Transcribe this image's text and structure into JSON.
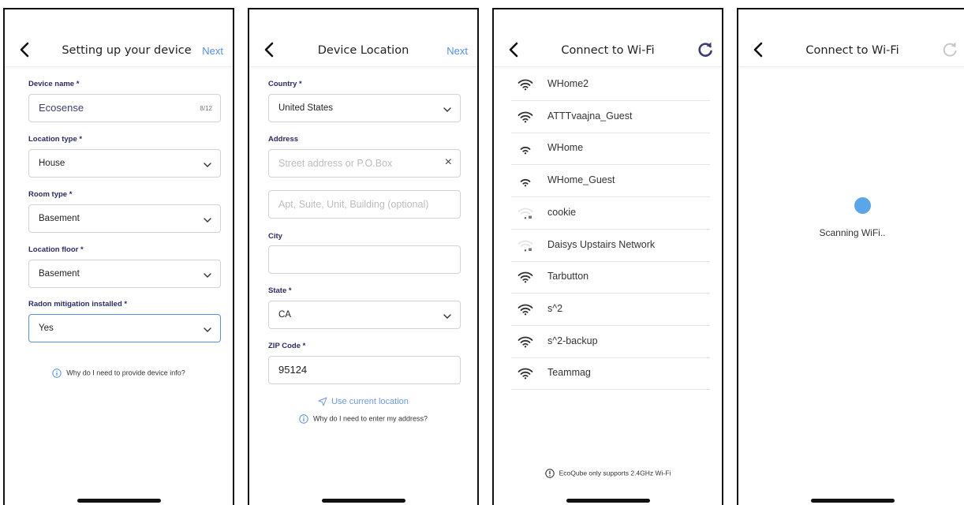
{
  "screen1": {
    "title": "Setting up your device",
    "next_label": "Next",
    "fields": [
      {
        "label": "Device name *",
        "value": "Ecosense",
        "counter": "8/12"
      },
      {
        "label": "Location type *",
        "value": "House"
      },
      {
        "label": "Room type *",
        "value": "Basement"
      },
      {
        "label": "Location floor *",
        "value": "Basement"
      },
      {
        "label": "Radon mitigation installed *",
        "value": "Yes"
      }
    ],
    "info_text": "Why do I need to provide device info?"
  },
  "screen2": {
    "title": "Device Location",
    "next_label": "Next",
    "country_label": "Country *",
    "country_value": "United States",
    "address_label": "Address",
    "address_placeholder": "Street address or P.O.Box",
    "clear_icon": "×",
    "apt_placeholder": "Apt, Suite, Unit, Building (optional)",
    "city_label": "City",
    "city_value": "",
    "state_label": "State *",
    "state_value": "CA",
    "zip_label": "ZIP Code *",
    "zip_value": "95124",
    "use_location": "Use current location",
    "info_text": "Why do I need to enter my address?"
  },
  "screen3": {
    "title": "Connect to Wi-Fi",
    "networks": [
      {
        "name": "WHome2",
        "strength": "full"
      },
      {
        "name": "ATTTvaajna_Guest",
        "strength": "full"
      },
      {
        "name": "WHome",
        "strength": "medium"
      },
      {
        "name": "WHome_Guest",
        "strength": "medium"
      },
      {
        "name": "cookie",
        "strength": "weak-locked"
      },
      {
        "name": "Daisys Upstairs Network",
        "strength": "weak-locked"
      },
      {
        "name": "Tarbutton",
        "strength": "full"
      },
      {
        "name": "s^2",
        "strength": "full"
      },
      {
        "name": "s^2-backup",
        "strength": "full"
      },
      {
        "name": "Teammag",
        "strength": "full"
      }
    ],
    "note": "EcoQube only supports 2.4GHz Wi-Fi"
  },
  "screen4": {
    "title": "Connect to Wi-Fi",
    "status": "Scanning WiFi.."
  },
  "colors": {
    "accent": "#4f8ff0",
    "label": "#2a2a6a",
    "spinner": "#5aa6e8",
    "refresh_active": "#3c3c78",
    "refresh_disabled": "#c8c8c8"
  },
  "icons": [
    "back-arrow-icon",
    "chevron-down-icon",
    "clear-icon",
    "info-icon",
    "location-arrow-icon",
    "wifi-icon",
    "refresh-icon"
  ]
}
